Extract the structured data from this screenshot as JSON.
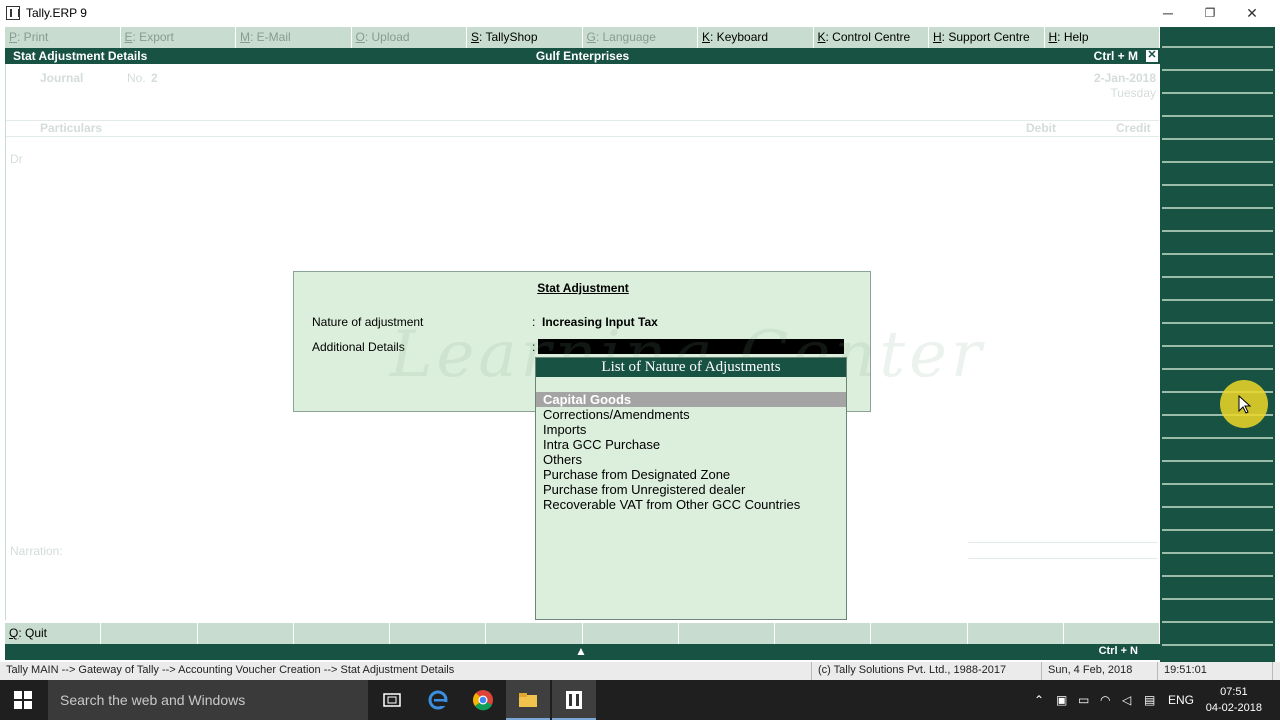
{
  "window": {
    "title": "Tally.ERP 9",
    "minimize": "─",
    "restore": "❐",
    "close": "✕"
  },
  "topbar": [
    {
      "key": "P",
      "label": ": Print",
      "enabled": false
    },
    {
      "key": "E",
      "label": ": Export",
      "enabled": false
    },
    {
      "key": "M",
      "label": ": E-Mail",
      "enabled": false
    },
    {
      "key": "O",
      "label": ": Upload",
      "enabled": false
    },
    {
      "key": "S",
      "label": ": TallyShop",
      "enabled": true
    },
    {
      "key": "G",
      "label": ": Language",
      "enabled": false
    },
    {
      "key": "K",
      "label": ": Keyboard",
      "enabled": true
    },
    {
      "key": "K",
      "label": ": Control Centre",
      "enabled": true
    },
    {
      "key": "H",
      "label": ": Support Centre",
      "enabled": true
    },
    {
      "key": "H",
      "label": ": Help",
      "enabled": true
    }
  ],
  "header": {
    "screen": "Stat Adjustment Details",
    "company": "Gulf Enterprises",
    "shortcut": "Ctrl + M",
    "close": "✕"
  },
  "voucher": {
    "type": "Journal",
    "no_label": "No.",
    "no": "2",
    "date": "2-Jan-2018",
    "day": "Tuesday",
    "col_particulars": "Particulars",
    "col_debit": "Debit",
    "col_credit": "Credit",
    "dr": "Dr",
    "narration": "Narration:"
  },
  "dialog": {
    "title": "Stat Adjustment",
    "nature_label": "Nature of adjustment",
    "nature_value": "Increasing Input Tax",
    "details_label": "Additional Details",
    "colon": ":",
    "details_value": "",
    "watermark": "Learning Center"
  },
  "list": {
    "title": "List of Nature of Adjustments",
    "items": [
      "Capital Goods",
      "Corrections/Amendments",
      "Imports",
      "Intra GCC Purchase",
      "Others",
      "Purchase from Designated Zone",
      "Purchase from Unregistered dealer",
      "Recoverable VAT from Other GCC Countries"
    ],
    "selected_index": 0
  },
  "bottombar": {
    "quit_key": "Q",
    "quit_label": ": Quit",
    "shortcut": "Ctrl + N",
    "up_arrow": "▲"
  },
  "status": {
    "breadcrumb": "Tally MAIN --> Gateway of Tally --> Accounting Voucher  Creation  --> Stat Adjustment Details",
    "copyright": "(c) Tally Solutions Pvt. Ltd., 1988-2017",
    "date": "Sun, 4 Feb, 2018",
    "time": "19:51:01"
  },
  "taskbar": {
    "search_placeholder": "Search the web and Windows",
    "language": "ENG",
    "clock_time": "07:51",
    "clock_date": "04-02-2018"
  },
  "colors": {
    "tally_green": "#185242",
    "panel_light": "#dcefdc",
    "button_bar": "#c8ddcf",
    "selection": "#a4a4a4"
  }
}
